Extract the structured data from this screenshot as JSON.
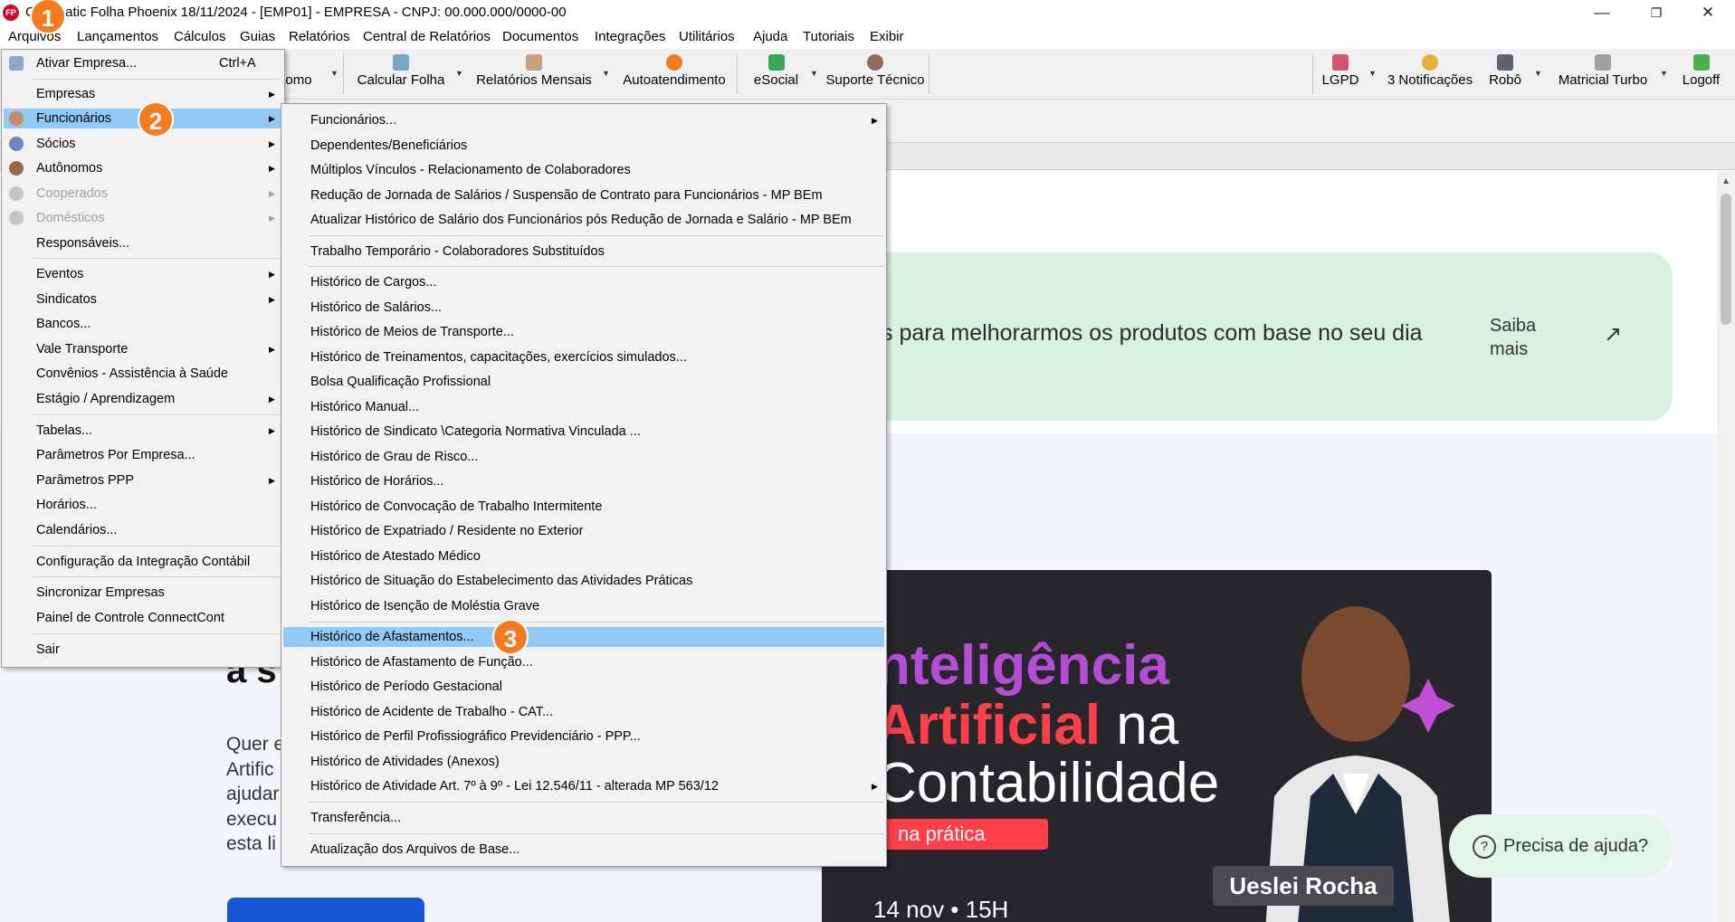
{
  "window": {
    "logo": "FP",
    "title": "Contmatic Folha Phoenix 18/11/2024 - [EMP01] - EMPRESA - CNPJ: 00.000.000/0000-00",
    "minimize": "—",
    "restore": "❐",
    "close": "✕"
  },
  "menubar": [
    "Arquivos",
    "Lançamentos",
    "Cálculos",
    "Guias",
    "Relatórios",
    "Central de Relatórios",
    "Documentos",
    "Integrações",
    "Utilitários",
    "Ajuda",
    "Tutoriais",
    "Exibir"
  ],
  "toolbar": {
    "items_left": [
      "omo",
      "Calcular Folha",
      "Relatórios Mensais",
      "Autoatendimento",
      "eSocial",
      "Suporte Técnico"
    ],
    "items_right": [
      "LGPD",
      "3 Notificações",
      "Robô",
      "Matricial Turbo",
      "Logoff"
    ],
    "icons": {
      "calcular-folha": "calculator-icon",
      "relatorios-mensais": "report-icon",
      "autoatendimento": "alert-icon",
      "esocial": "esocial-icon",
      "suporte-tecnico": "support-icon",
      "lgpd": "lgpd-icon",
      "notificacoes": "bell-icon",
      "robo": "robot-icon",
      "matricial-turbo": "printer-icon",
      "logoff": "logoff-icon"
    }
  },
  "arquivos_menu": {
    "items": [
      {
        "label": "Ativar Empresa...",
        "shortcut": "Ctrl+A",
        "icon": "activate-company-icon"
      },
      {
        "label": "Empresas",
        "submenu": true
      },
      {
        "label": "Funcionários",
        "submenu": true,
        "selected": true,
        "icon": "employee-icon"
      },
      {
        "label": "Sócios",
        "submenu": true,
        "icon": "partner-icon"
      },
      {
        "label": "Autônomos",
        "submenu": true,
        "icon": "autonomous-icon"
      },
      {
        "label": "Cooperados",
        "submenu": true,
        "disabled": true,
        "icon": "cooperative-icon"
      },
      {
        "label": "Domésticos",
        "submenu": true,
        "disabled": true,
        "icon": "domestic-icon"
      },
      {
        "label": "Responsáveis..."
      },
      {
        "label": "Eventos",
        "submenu": true
      },
      {
        "label": "Sindicatos",
        "submenu": true
      },
      {
        "label": "Bancos..."
      },
      {
        "label": "Vale Transporte",
        "submenu": true
      },
      {
        "label": "Convênios - Assistência à Saúde"
      },
      {
        "label": "Estágio / Aprendizagem",
        "submenu": true
      },
      {
        "label": "Tabelas...",
        "submenu": true
      },
      {
        "label": "Parâmetros Por Empresa..."
      },
      {
        "label": "Parâmetros PPP",
        "submenu": true
      },
      {
        "label": "Horários..."
      },
      {
        "label": "Calendários..."
      },
      {
        "label": "Configuração da Integração Contábil"
      },
      {
        "label": "Sincronizar Empresas"
      },
      {
        "label": "Painel de Controle ConnectCont"
      },
      {
        "label": "Sair"
      }
    ]
  },
  "funcionarios_submenu": {
    "items": [
      {
        "label": "Funcionários...",
        "submenu": true
      },
      {
        "label": "Dependentes/Beneficiários"
      },
      {
        "label": "Múltiplos Vínculos - Relacionamento de Colaboradores"
      },
      {
        "label": "Redução de Jornada de Salários / Suspensão de Contrato para Funcionários - MP BEm"
      },
      {
        "label": "Atualizar Histórico de Salário dos Funcionários pós Redução de Jornada e Salário - MP BEm"
      },
      {
        "label": "Trabalho Temporário - Colaboradores Substituídos"
      },
      {
        "label": "Histórico de Cargos..."
      },
      {
        "label": "Histórico de Salários..."
      },
      {
        "label": "Histórico de Meios de Transporte..."
      },
      {
        "label": "Histórico de Treinamentos, capacitações, exercícios simulados..."
      },
      {
        "label": "Bolsa Qualificação Profissional"
      },
      {
        "label": "Histórico Manual..."
      },
      {
        "label": "Histórico de Sindicato \\Categoria Normativa Vinculada ..."
      },
      {
        "label": "Histórico de Grau de Risco..."
      },
      {
        "label": "Histórico de Horários..."
      },
      {
        "label": "Histórico de Convocação de Trabalho Intermitente"
      },
      {
        "label": "Histórico de Expatriado / Residente no Exterior"
      },
      {
        "label": "Histórico de Atestado Médico"
      },
      {
        "label": "Histórico de Situação do Estabelecimento das Atividades Práticas"
      },
      {
        "label": "Histórico de Isenção de Moléstia Grave"
      },
      {
        "label": "Histórico de Afastamentos...",
        "selected": true
      },
      {
        "label": "Histórico de Afastamento de Função..."
      },
      {
        "label": "Histórico de Período Gestacional"
      },
      {
        "label": "Histórico de Acidente de Trabalho - CAT..."
      },
      {
        "label": "Histórico de Perfil Profissiográfico Previdenciário - PPP..."
      },
      {
        "label": "Histórico de Atividades (Anexos)"
      },
      {
        "label": "Histórico de Atividade Art. 7º à 9º - Lei 12.546/11 - alterada MP 563/12",
        "submenu": true
      },
      {
        "label": "Transferência..."
      },
      {
        "label": "Atualização dos Arquivos de Base..."
      }
    ]
  },
  "web": {
    "banner_text": "s para melhorarmos os produtos com base no seu dia",
    "saiba_mais": "Saiba mais",
    "saiba_arrow": "↗",
    "left_heading": "a s",
    "left_para": [
      "Quer e",
      "Artific",
      "ajudar",
      "execu",
      "esta li"
    ],
    "promo": {
      "line1": "nteligência",
      "line2": "Artificial",
      "line2_na": " na",
      "line3": "Contabilidade",
      "badge": "na prática",
      "date": "14 nov • 15H",
      "presenter": "Ueslei Rocha"
    },
    "help": "Precisa de ajuda?",
    "help_icon": "?"
  },
  "callouts": [
    "1",
    "2",
    "3"
  ],
  "colors": {
    "selection": "#91c9f7",
    "callout": "#f47b20",
    "banner": "#d9f2e0",
    "promo_bg": "#26262b"
  }
}
